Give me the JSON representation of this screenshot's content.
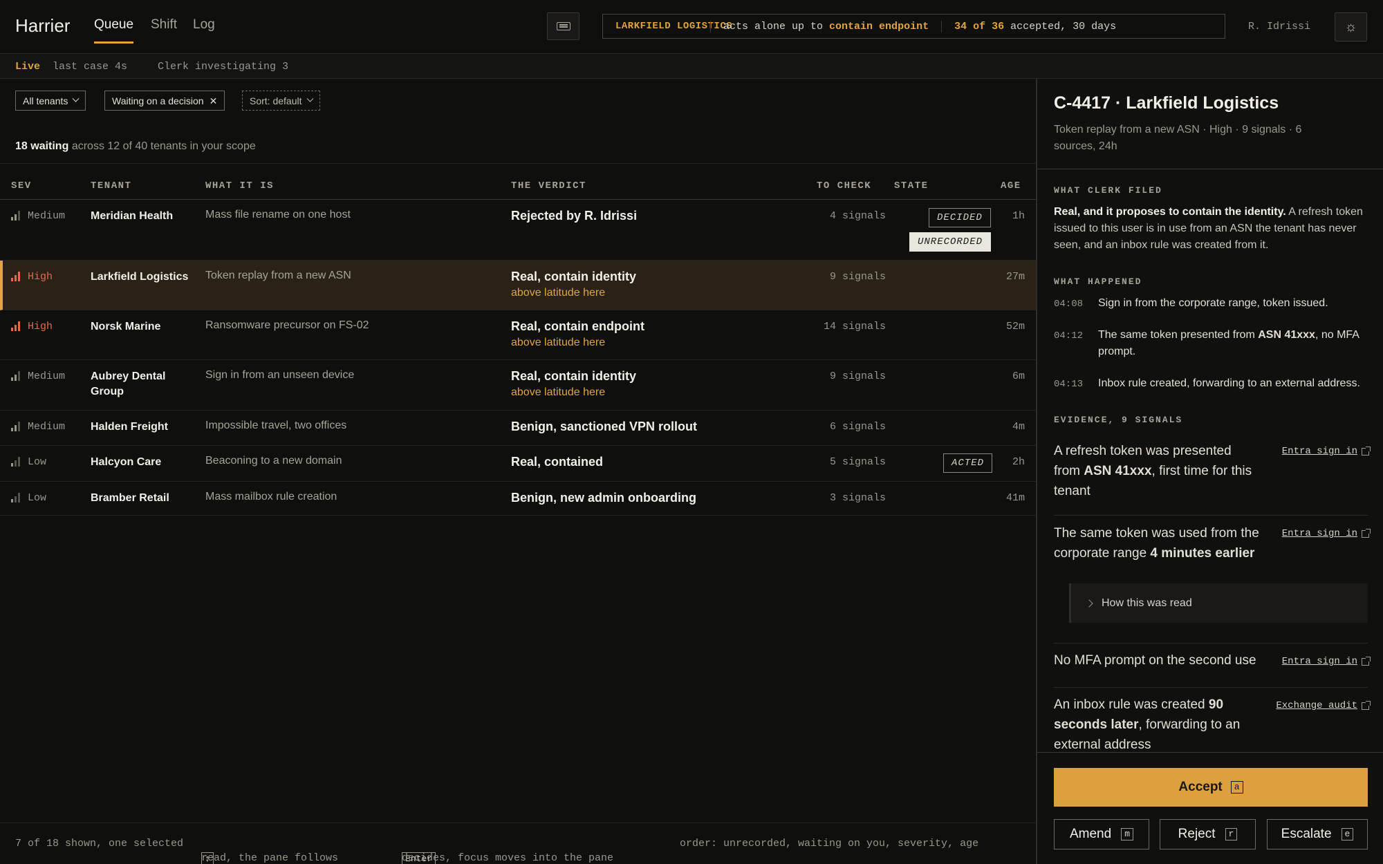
{
  "app": {
    "name": "Harrier",
    "tabs": [
      {
        "label": "Queue"
      },
      {
        "label": "Shift"
      },
      {
        "label": "Log"
      }
    ],
    "active_tab": "Queue",
    "user": "R. Idrissi"
  },
  "policy": {
    "tenant": "LARKFIELD LOGISTICS",
    "acts_prefix": "acts alone up to",
    "acts_scope": "contain endpoint",
    "accepted_count": "34 of 36",
    "accepted_suffix": "accepted, 30 days"
  },
  "status": {
    "live": "Live",
    "last_case": "last case 4s",
    "clerk": "Clerk investigating 3"
  },
  "filters": {
    "tenants": "All tenants",
    "waiting": "Waiting on a decision",
    "sort": "Sort: default"
  },
  "summary": {
    "count": "18 waiting",
    "scope": "across 12 of 40 tenants in your scope"
  },
  "table": {
    "headers": {
      "sev": "SEV",
      "tenant": "TENANT",
      "what": "WHAT IT IS",
      "verdict": "THE VERDICT",
      "check": "TO CHECK",
      "state": "STATE",
      "age": "AGE"
    },
    "rows": [
      {
        "sev": "Medium",
        "tenant": "Meridian Health",
        "what": "Mass file rename on one host",
        "verdict": "Rejected by R. Idrissi",
        "verdict_sub": "",
        "check": "4 signals",
        "states": [
          "DECIDED",
          "UNRECORDED"
        ],
        "age": "1h"
      },
      {
        "sev": "High",
        "tenant": "Larkfield Logistics",
        "what": "Token replay from a new ASN",
        "verdict": "Real, contain identity",
        "verdict_sub": "above latitude here",
        "check": "9 signals",
        "states": [],
        "age": "27m"
      },
      {
        "sev": "High",
        "tenant": "Norsk Marine",
        "what": "Ransomware precursor on FS-02",
        "verdict": "Real, contain endpoint",
        "verdict_sub": "above latitude here",
        "check": "14 signals",
        "states": [],
        "age": "52m"
      },
      {
        "sev": "Medium",
        "tenant": "Aubrey Dental Group",
        "what": "Sign in from an unseen device",
        "verdict": "Real, contain identity",
        "verdict_sub": "above latitude here",
        "check": "9 signals",
        "states": [],
        "age": "6m"
      },
      {
        "sev": "Medium",
        "tenant": "Halden Freight",
        "what": "Impossible travel, two offices",
        "verdict": "Benign, sanctioned VPN rollout",
        "verdict_sub": "",
        "check": "6 signals",
        "states": [],
        "age": "4m"
      },
      {
        "sev": "Low",
        "tenant": "Halcyon Care",
        "what": "Beaconing to a new domain",
        "verdict": "Real, contained",
        "verdict_sub": "",
        "check": "5 signals",
        "states": [
          "ACTED"
        ],
        "age": "2h"
      },
      {
        "sev": "Low",
        "tenant": "Bramber Retail",
        "what": "Mass mailbox rule creation",
        "verdict": "Benign, new admin onboarding",
        "verdict_sub": "",
        "check": "3 signals",
        "states": [],
        "age": "41m"
      }
    ]
  },
  "footer": {
    "shown": "7 of 18 shown, one selected",
    "up_key": "↑",
    "down_key": "↓",
    "read": "read, the pane follows",
    "enter_key": "Enter",
    "decides": "decides, focus moves into the pane",
    "order": "order: unrecorded, waiting on you, severity, age"
  },
  "pane": {
    "title": "C-4417 · Larkfield Logistics",
    "subtitle": "Token replay from a new ASN · High · 9 signals · 6 sources, 24h",
    "filed_label": "WHAT CLERK FILED",
    "filed_bold": "Real, and it proposes to contain the identity.",
    "filed_rest": " A refresh token issued to this user is in use from an ASN the tenant has never seen, and an inbox rule was created from it.",
    "happened_label": "WHAT HAPPENED",
    "timeline": [
      {
        "time": "04:08",
        "text": "Sign in from the corporate range, token issued."
      },
      {
        "time": "04:12",
        "text_a": "The same token presented from ",
        "text_b": "ASN 41xxx",
        "text_c": ", no MFA prompt."
      },
      {
        "time": "04:13",
        "text": "Inbox rule created, forwarding to an external address."
      }
    ],
    "evidence_label": "EVIDENCE, 9 SIGNALS",
    "evidence": [
      {
        "a": "A refresh token was presented from ",
        "b": "ASN 41xxx",
        "c": ", first time for this tenant",
        "source": "Entra sign in"
      },
      {
        "a": "The same token was used from the corporate range ",
        "b": "4 minutes earlier",
        "c": "",
        "source": "Entra sign in"
      },
      {
        "a": "No MFA prompt on the second use",
        "b": "",
        "c": "",
        "source": "Entra sign in"
      },
      {
        "a": "An inbox rule was created ",
        "b": "90 seconds later",
        "c": ", forwarding to an external address",
        "source": "Exchange audit"
      }
    ],
    "how_read": "How this was read",
    "actions": {
      "accept": "Accept",
      "accept_key": "a",
      "amend": "Amend",
      "amend_key": "m",
      "reject": "Reject",
      "reject_key": "r",
      "escalate": "Escalate",
      "escalate_key": "e"
    }
  },
  "colors": {
    "accent": "#e0a540",
    "high": "#e46a4f",
    "background": "#0f0f0d",
    "selected_row": "#2a2217"
  }
}
